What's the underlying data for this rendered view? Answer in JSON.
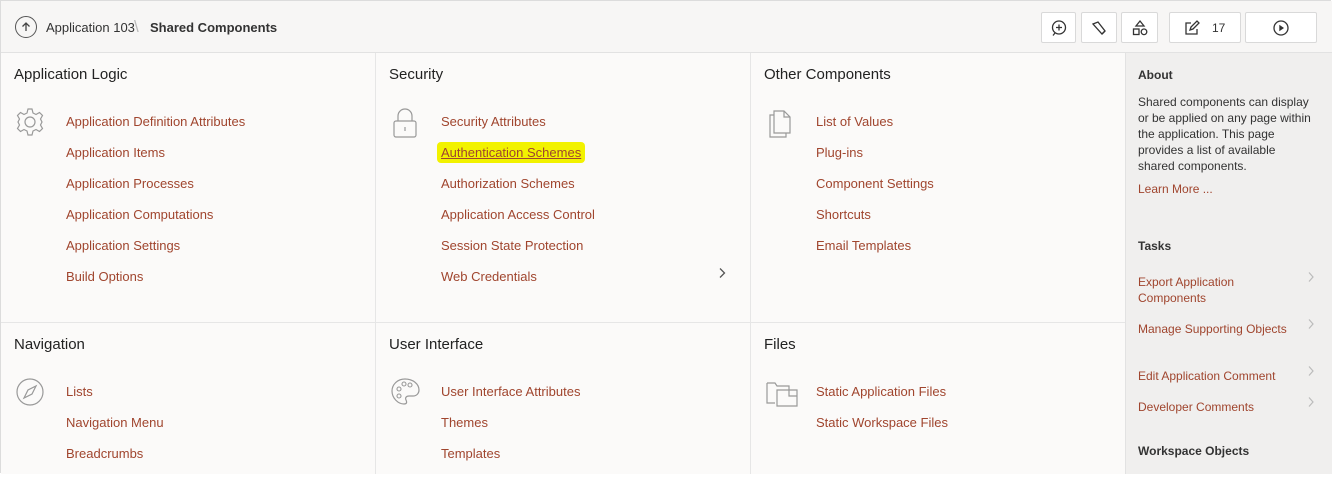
{
  "header": {
    "app_crumb": "Application 103",
    "page_crumb": "Shared Components",
    "edit_count": "17"
  },
  "sections": {
    "application_logic": {
      "title": "Application Logic",
      "items": [
        "Application Definition Attributes",
        "Application Items",
        "Application Processes",
        "Application Computations",
        "Application Settings",
        "Build Options"
      ]
    },
    "security": {
      "title": "Security",
      "items": [
        "Security Attributes",
        "Authentication Schemes",
        "Authorization Schemes",
        "Application Access Control",
        "Session State Protection",
        "Web Credentials"
      ]
    },
    "other_components": {
      "title": "Other Components",
      "items": [
        "List of Values",
        "Plug-ins",
        "Component Settings",
        "Shortcuts",
        "Email Templates"
      ]
    },
    "navigation": {
      "title": "Navigation",
      "items": [
        "Lists",
        "Navigation Menu",
        "Breadcrumbs"
      ]
    },
    "user_interface": {
      "title": "User Interface",
      "items": [
        "User Interface Attributes",
        "Themes",
        "Templates"
      ]
    },
    "files": {
      "title": "Files",
      "items": [
        "Static Application Files",
        "Static Workspace Files"
      ]
    }
  },
  "sidebar": {
    "about_title": "About",
    "about_text": "Shared components can display or be applied on any page within the application. This page provides a list of available shared components.",
    "learn_more": "Learn More ...",
    "tasks_title": "Tasks",
    "tasks": [
      "Export Application Components",
      "Manage Supporting Objects",
      "Edit Application Comment",
      "Developer Comments"
    ],
    "workspace_title": "Workspace Objects"
  },
  "colors": {
    "link": "#a0452e",
    "highlight": "#f2f200"
  },
  "icons": [
    "up-arrow-icon",
    "comment-add-icon",
    "flashlight-icon",
    "shapes-icon",
    "edit-icon",
    "run-icon",
    "gear-icon",
    "lock-icon",
    "documents-icon",
    "compass-icon",
    "palette-icon",
    "folders-icon",
    "chevron-right-icon"
  ]
}
